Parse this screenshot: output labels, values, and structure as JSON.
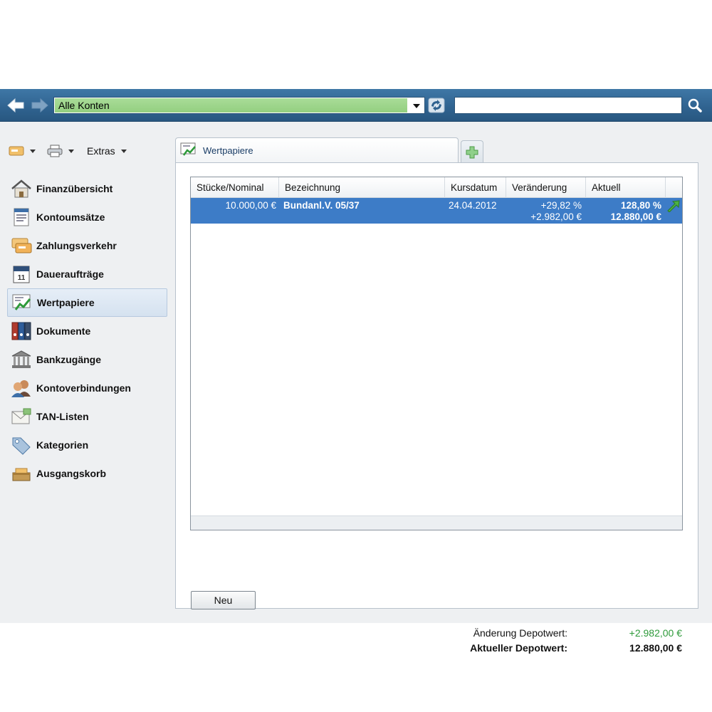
{
  "header": {
    "account_select_value": "Alle Konten",
    "search_value": ""
  },
  "toolbar": {
    "extras_label": "Extras"
  },
  "sidebar": {
    "items": [
      {
        "label": "Finanzübersicht",
        "icon": "house-icon"
      },
      {
        "label": "Kontoumsätze",
        "icon": "statement-icon"
      },
      {
        "label": "Zahlungsverkehr",
        "icon": "transfer-icon"
      },
      {
        "label": "Daueraufträge",
        "icon": "calendar-icon"
      },
      {
        "label": "Wertpapiere",
        "icon": "securities-chart-icon",
        "active": true
      },
      {
        "label": "Dokumente",
        "icon": "binders-icon"
      },
      {
        "label": "Bankzugänge",
        "icon": "bank-icon"
      },
      {
        "label": "Kontoverbindungen",
        "icon": "contacts-icon"
      },
      {
        "label": "TAN-Listen",
        "icon": "envelope-icon"
      },
      {
        "label": "Kategorien",
        "icon": "tag-icon"
      },
      {
        "label": "Ausgangskorb",
        "icon": "outbox-icon"
      }
    ]
  },
  "tabs": {
    "active_label": "Wertpapiere"
  },
  "table": {
    "columns": [
      "Stücke/Nominal",
      "Bezeichnung",
      "Kursdatum",
      "Veränderung",
      "Aktuell"
    ],
    "rows": [
      {
        "nominal": "10.000,00 €",
        "name": "Bundanl.V. 05/37",
        "date": "24.04.2012",
        "change_pct": "+29,82 %",
        "change_abs": "+2.982,00 €",
        "current_pct": "128,80 %",
        "current_abs": "12.880,00 €"
      }
    ]
  },
  "summary": {
    "change_label": "Änderung Depotwert:",
    "change_value": "+2.982,00 €",
    "current_label": "Aktueller Depotwert:",
    "current_value": "12.880,00 €"
  },
  "actions": {
    "new_label": "Neu"
  },
  "colors": {
    "topbar": "#2f628f",
    "selection": "#3d7cc7",
    "positive": "#2e9a3a",
    "account_select": "#93cf80"
  }
}
